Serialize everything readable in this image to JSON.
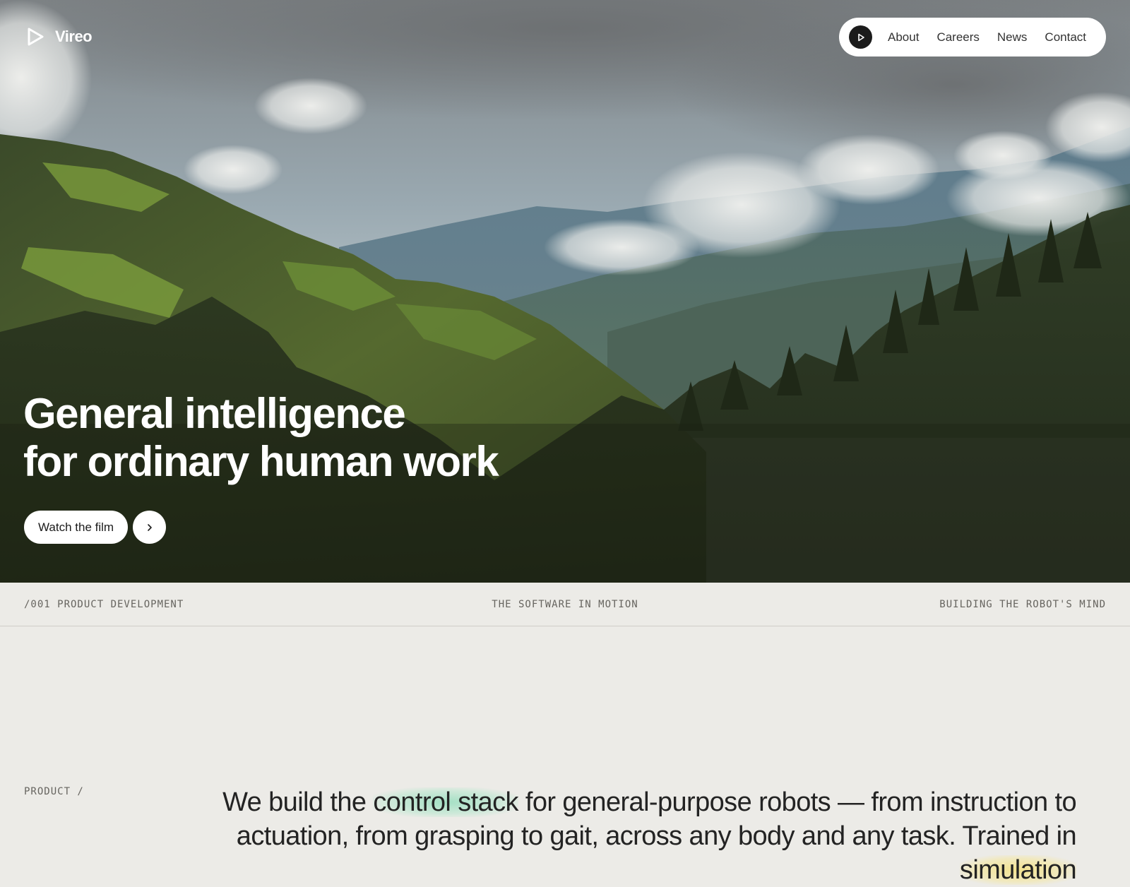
{
  "brand": {
    "name": "Vireo",
    "logo_icon": "play-triangle-icon"
  },
  "nav": {
    "play_icon": "play-icon",
    "items": [
      {
        "label": "About"
      },
      {
        "label": "Careers"
      },
      {
        "label": "News"
      },
      {
        "label": "Contact"
      }
    ]
  },
  "hero": {
    "headline_line1": "General intelligence",
    "headline_line2": "for ordinary human work",
    "cta_label": "Watch the film",
    "cta_arrow_icon": "chevron-right-icon",
    "background": "mountain-valley-forest-photo"
  },
  "strip": {
    "left": "/001 PRODUCT DEVELOPMENT",
    "center": "THE SOFTWARE IN MOTION",
    "right": "BUILDING THE ROBOT'S MIND"
  },
  "product": {
    "label": "PRODUCT /",
    "text_1": "We build the ",
    "highlight_1": "control stack",
    "text_2": " for general-purpose robots — from instruction to actuation, from grasping to gait, across any body and any task. Trained in ",
    "highlight_2": "simulation"
  },
  "colors": {
    "page_bg": "#ecebe7",
    "text_dark": "#232323",
    "mono_text": "#66645f",
    "highlight_green": "#8cdcb9",
    "highlight_yellow": "#f5e178"
  }
}
